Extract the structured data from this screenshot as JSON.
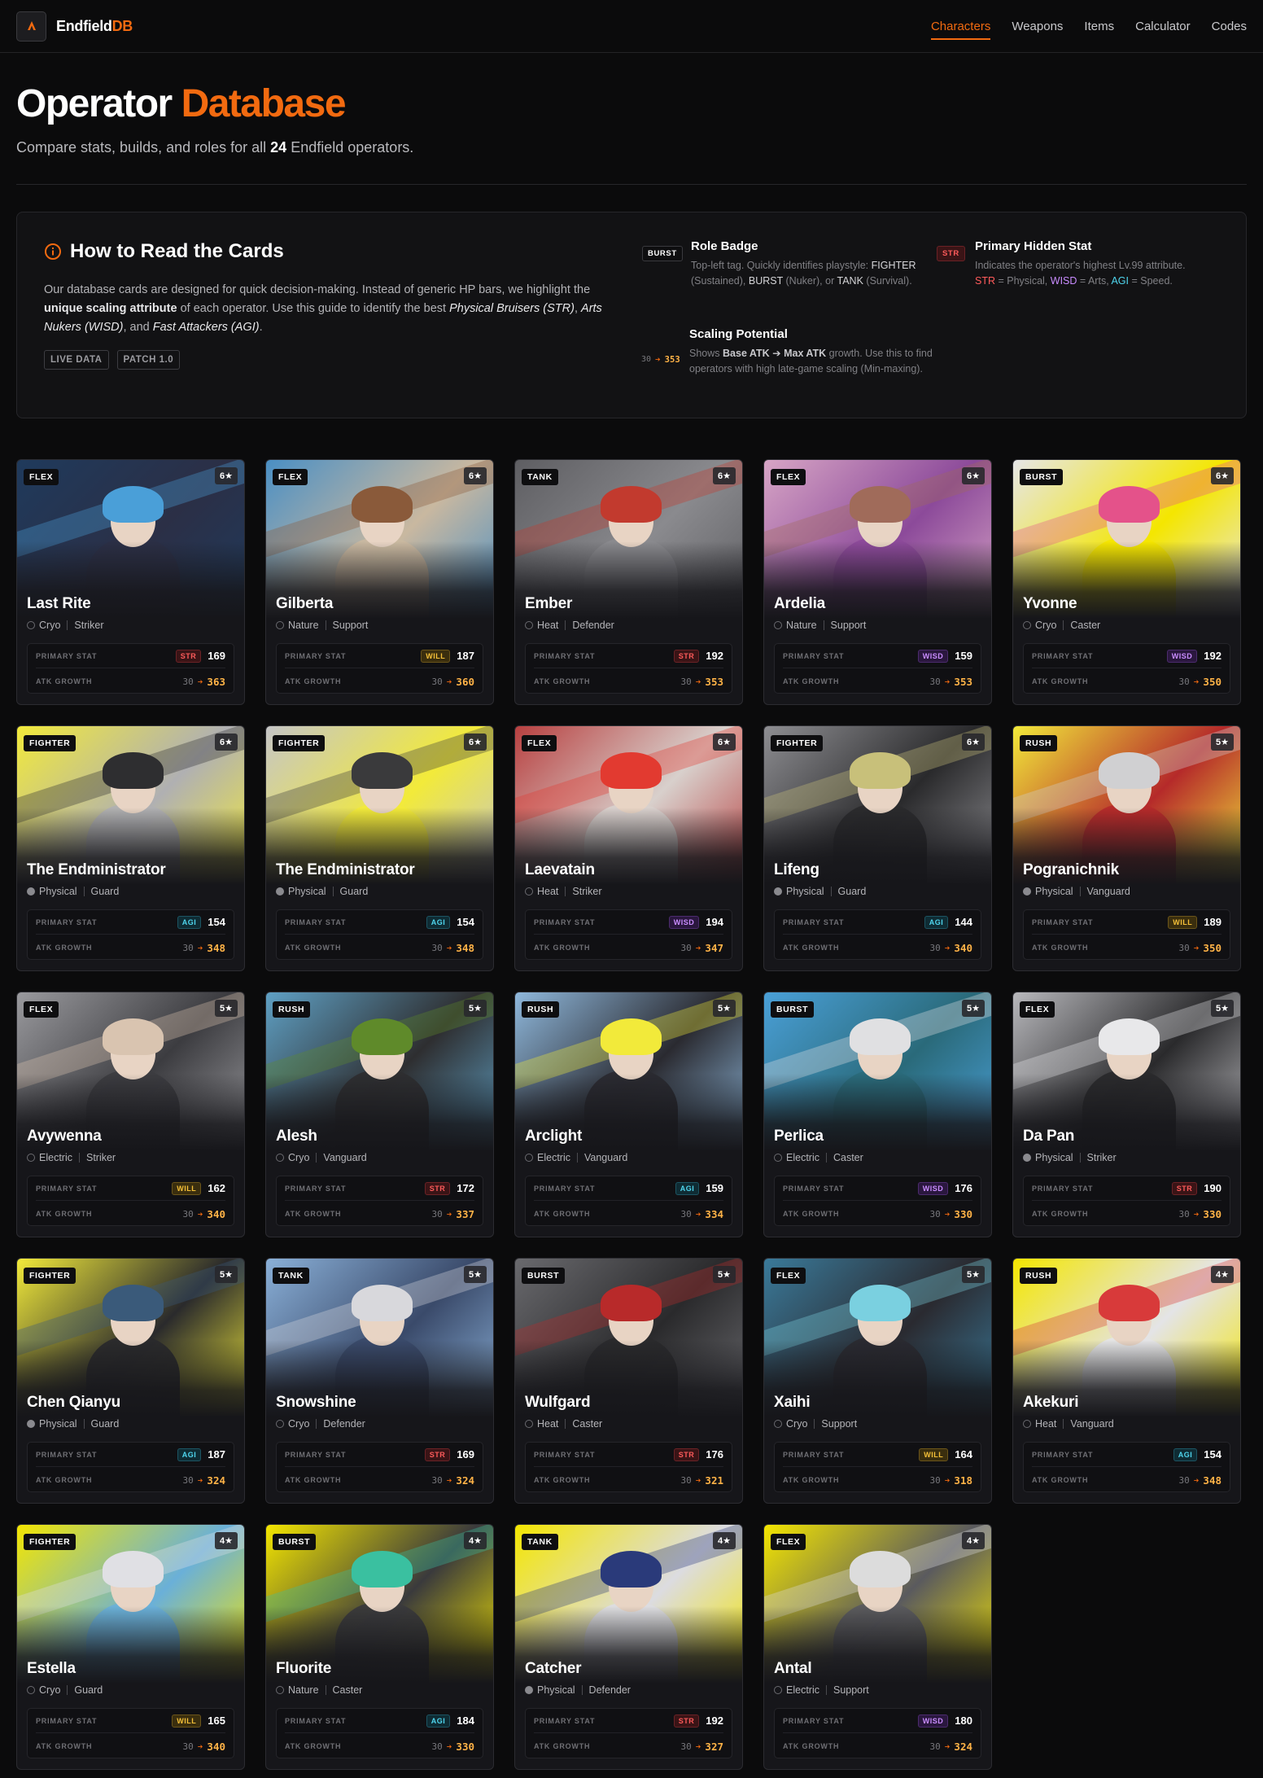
{
  "nav": {
    "brand_main": "Endfield",
    "brand_accent": "DB",
    "links": [
      "Characters",
      "Weapons",
      "Items",
      "Calculator",
      "Codes"
    ],
    "active": "Characters"
  },
  "header": {
    "title_main": "Operator",
    "title_accent": "Database",
    "subtitle_pre": "Compare stats, builds, and roles for all",
    "subtitle_count": "24",
    "subtitle_post": "Endfield operators."
  },
  "guide": {
    "title": "How to Read the Cards",
    "p1": "Our database cards are designed for quick decision-making. Instead of generic HP bars, we highlight the",
    "p2": "unique scaling attribute",
    "p3": "of each operator. Use this guide to identify the best",
    "p4": "Physical Bruisers (STR)",
    "p5": ",",
    "p6": "Arts Nukers (WISD)",
    "p7": ", and",
    "p8": "Fast Attackers (AGI)",
    "p9": ".",
    "tags": [
      "LIVE DATA",
      "PATCH 1.0"
    ],
    "role_badge": {
      "badge": "BURST",
      "title": "Role Badge",
      "d1": "Top-left tag. Quickly identifies playstyle:",
      "d2": "FIGHTER",
      "d3": "(Sustained),",
      "d4": "BURST",
      "d5": "(Nuker), or",
      "d6": "TANK",
      "d7": "(Survival)."
    },
    "primary_stat": {
      "badge": "STR",
      "title": "Primary Hidden Stat",
      "d1": "Indicates the operator's highest Lv.99 attribute.",
      "s1": "STR",
      "e1": "= Physical,",
      "s2": "WISD",
      "e2": "= Arts,",
      "s3": "AGI",
      "e3": "= Speed."
    },
    "scaling": {
      "base": "30",
      "max": "353",
      "title": "Scaling Potential",
      "d1": "Shows",
      "d2": "Base ATK ➔ Max ATK",
      "d3": "growth. Use this to find operators with high late-game scaling (Min-maxing)."
    }
  },
  "labels": {
    "primary_stat": "PRIMARY STAT",
    "atk_growth": "ATK GROWTH"
  },
  "operators": [
    {
      "name": "Last Rite",
      "role": "FLEX",
      "rarity": "6★",
      "element": "Cryo",
      "cls": "Striker",
      "stat": "STR",
      "stat_val": "169",
      "base": "30",
      "max": "363",
      "palette": [
        "#1f3a5c",
        "#4a9fd8",
        "#2b2f46"
      ]
    },
    {
      "name": "Gilberta",
      "role": "FLEX",
      "rarity": "6★",
      "element": "Nature",
      "cls": "Support",
      "stat": "WILL",
      "stat_val": "187",
      "base": "30",
      "max": "360",
      "palette": [
        "#4a8fc4",
        "#8a5a3a",
        "#c9b8a0"
      ]
    },
    {
      "name": "Ember",
      "role": "TANK",
      "rarity": "6★",
      "element": "Heat",
      "cls": "Defender",
      "stat": "STR",
      "stat_val": "192",
      "base": "30",
      "max": "353",
      "palette": [
        "#5e5e62",
        "#c23a2e",
        "#8a8a8e"
      ]
    },
    {
      "name": "Ardelia",
      "role": "FLEX",
      "rarity": "6★",
      "element": "Nature",
      "cls": "Support",
      "stat": "WISD",
      "stat_val": "159",
      "base": "30",
      "max": "353",
      "palette": [
        "#d7a5c5",
        "#a06b5a",
        "#8c4a9a"
      ]
    },
    {
      "name": "Yvonne",
      "role": "BURST",
      "rarity": "6★",
      "element": "Cryo",
      "cls": "Caster",
      "stat": "WISD",
      "stat_val": "192",
      "base": "30",
      "max": "350",
      "palette": [
        "#e6e6e8",
        "#e4528a",
        "#f4e600"
      ]
    },
    {
      "name": "The Endministrator",
      "role": "FIGHTER",
      "rarity": "6★",
      "element": "Physical",
      "cls": "Guard",
      "stat": "AGI",
      "stat_val": "154",
      "base": "30",
      "max": "348",
      "palette": [
        "#f2ea3a",
        "#2e2e30",
        "#b0b0b2"
      ]
    },
    {
      "name": "The Endministrator",
      "role": "FIGHTER",
      "rarity": "6★",
      "element": "Physical",
      "cls": "Guard",
      "stat": "AGI",
      "stat_val": "154",
      "base": "30",
      "max": "348",
      "palette": [
        "#c5c5c7",
        "#3a3a3c",
        "#f2ea3a"
      ]
    },
    {
      "name": "Laevatain",
      "role": "FLEX",
      "rarity": "6★",
      "element": "Heat",
      "cls": "Striker",
      "stat": "WISD",
      "stat_val": "194",
      "base": "30",
      "max": "347",
      "palette": [
        "#b84040",
        "#e23a30",
        "#d8d0cc"
      ]
    },
    {
      "name": "Lifeng",
      "role": "FIGHTER",
      "rarity": "6★",
      "element": "Physical",
      "cls": "Guard",
      "stat": "AGI",
      "stat_val": "144",
      "base": "30",
      "max": "340",
      "palette": [
        "#8e8e92",
        "#c8c07a",
        "#2a2a2c"
      ]
    },
    {
      "name": "Pogranichnik",
      "role": "RUSH",
      "rarity": "5★",
      "element": "Physical",
      "cls": "Vanguard",
      "stat": "WILL",
      "stat_val": "189",
      "base": "30",
      "max": "350",
      "palette": [
        "#f2ea3a",
        "#d0d0d2",
        "#b52a2a"
      ]
    },
    {
      "name": "Avywenna",
      "role": "FLEX",
      "rarity": "5★",
      "element": "Electric",
      "cls": "Striker",
      "stat": "WILL",
      "stat_val": "162",
      "base": "30",
      "max": "340",
      "palette": [
        "#9a9a9e",
        "#d9c4b0",
        "#3c3c40"
      ]
    },
    {
      "name": "Alesh",
      "role": "RUSH",
      "rarity": "5★",
      "element": "Cryo",
      "cls": "Vanguard",
      "stat": "STR",
      "stat_val": "172",
      "base": "30",
      "max": "337",
      "palette": [
        "#5fa0c4",
        "#5f8a2a",
        "#2e2e30"
      ]
    },
    {
      "name": "Arclight",
      "role": "RUSH",
      "rarity": "5★",
      "element": "Electric",
      "cls": "Vanguard",
      "stat": "AGI",
      "stat_val": "159",
      "base": "30",
      "max": "334",
      "palette": [
        "#8fb8dc",
        "#f2ea3a",
        "#2a2a30"
      ]
    },
    {
      "name": "Perlica",
      "role": "BURST",
      "rarity": "5★",
      "element": "Electric",
      "cls": "Caster",
      "stat": "WISD",
      "stat_val": "176",
      "base": "30",
      "max": "330",
      "palette": [
        "#4aa0d8",
        "#e0e0e2",
        "#2a6a7a"
      ]
    },
    {
      "name": "Da Pan",
      "role": "FLEX",
      "rarity": "5★",
      "element": "Physical",
      "cls": "Striker",
      "stat": "STR",
      "stat_val": "190",
      "base": "30",
      "max": "330",
      "palette": [
        "#b8b8bc",
        "#e8e8ea",
        "#2a2a2c"
      ]
    },
    {
      "name": "Chen Qianyu",
      "role": "FIGHTER",
      "rarity": "5★",
      "element": "Physical",
      "cls": "Guard",
      "stat": "AGI",
      "stat_val": "187",
      "base": "30",
      "max": "324",
      "palette": [
        "#f2ea3a",
        "#3a5a7a",
        "#2a2a2c"
      ]
    },
    {
      "name": "Snowshine",
      "role": "TANK",
      "rarity": "5★",
      "element": "Cryo",
      "cls": "Defender",
      "stat": "STR",
      "stat_val": "169",
      "base": "30",
      "max": "324",
      "palette": [
        "#8ab0d8",
        "#d8d8dc",
        "#3a4a6a"
      ]
    },
    {
      "name": "Wulfgard",
      "role": "BURST",
      "rarity": "5★",
      "element": "Heat",
      "cls": "Caster",
      "stat": "STR",
      "stat_val": "176",
      "base": "30",
      "max": "321",
      "palette": [
        "#6a6a6e",
        "#b82a2a",
        "#2a2a2c"
      ]
    },
    {
      "name": "Xaihi",
      "role": "FLEX",
      "rarity": "5★",
      "element": "Cryo",
      "cls": "Support",
      "stat": "WILL",
      "stat_val": "164",
      "base": "30",
      "max": "318",
      "palette": [
        "#3a7a9a",
        "#7ad0e0",
        "#2a2a30"
      ]
    },
    {
      "name": "Akekuri",
      "role": "RUSH",
      "rarity": "4★",
      "element": "Heat",
      "cls": "Vanguard",
      "stat": "AGI",
      "stat_val": "154",
      "base": "30",
      "max": "348",
      "palette": [
        "#f4e600",
        "#d83a3a",
        "#e4e4e6"
      ]
    },
    {
      "name": "Estella",
      "role": "FIGHTER",
      "rarity": "4★",
      "element": "Cryo",
      "cls": "Guard",
      "stat": "WILL",
      "stat_val": "165",
      "base": "30",
      "max": "340",
      "palette": [
        "#f4e600",
        "#e0e0e4",
        "#6ab0d8"
      ]
    },
    {
      "name": "Fluorite",
      "role": "BURST",
      "rarity": "4★",
      "element": "Nature",
      "cls": "Caster",
      "stat": "AGI",
      "stat_val": "184",
      "base": "30",
      "max": "330",
      "palette": [
        "#f4e600",
        "#3ac0a0",
        "#3a3a3c"
      ]
    },
    {
      "name": "Catcher",
      "role": "TANK",
      "rarity": "4★",
      "element": "Physical",
      "cls": "Defender",
      "stat": "STR",
      "stat_val": "192",
      "base": "30",
      "max": "327",
      "palette": [
        "#f4e600",
        "#2a3a7a",
        "#dcdce0"
      ]
    },
    {
      "name": "Antal",
      "role": "FLEX",
      "rarity": "4★",
      "element": "Electric",
      "cls": "Support",
      "stat": "WISD",
      "stat_val": "180",
      "base": "30",
      "max": "324",
      "palette": [
        "#f4e600",
        "#dcdcdc",
        "#5a5a5e"
      ]
    }
  ]
}
